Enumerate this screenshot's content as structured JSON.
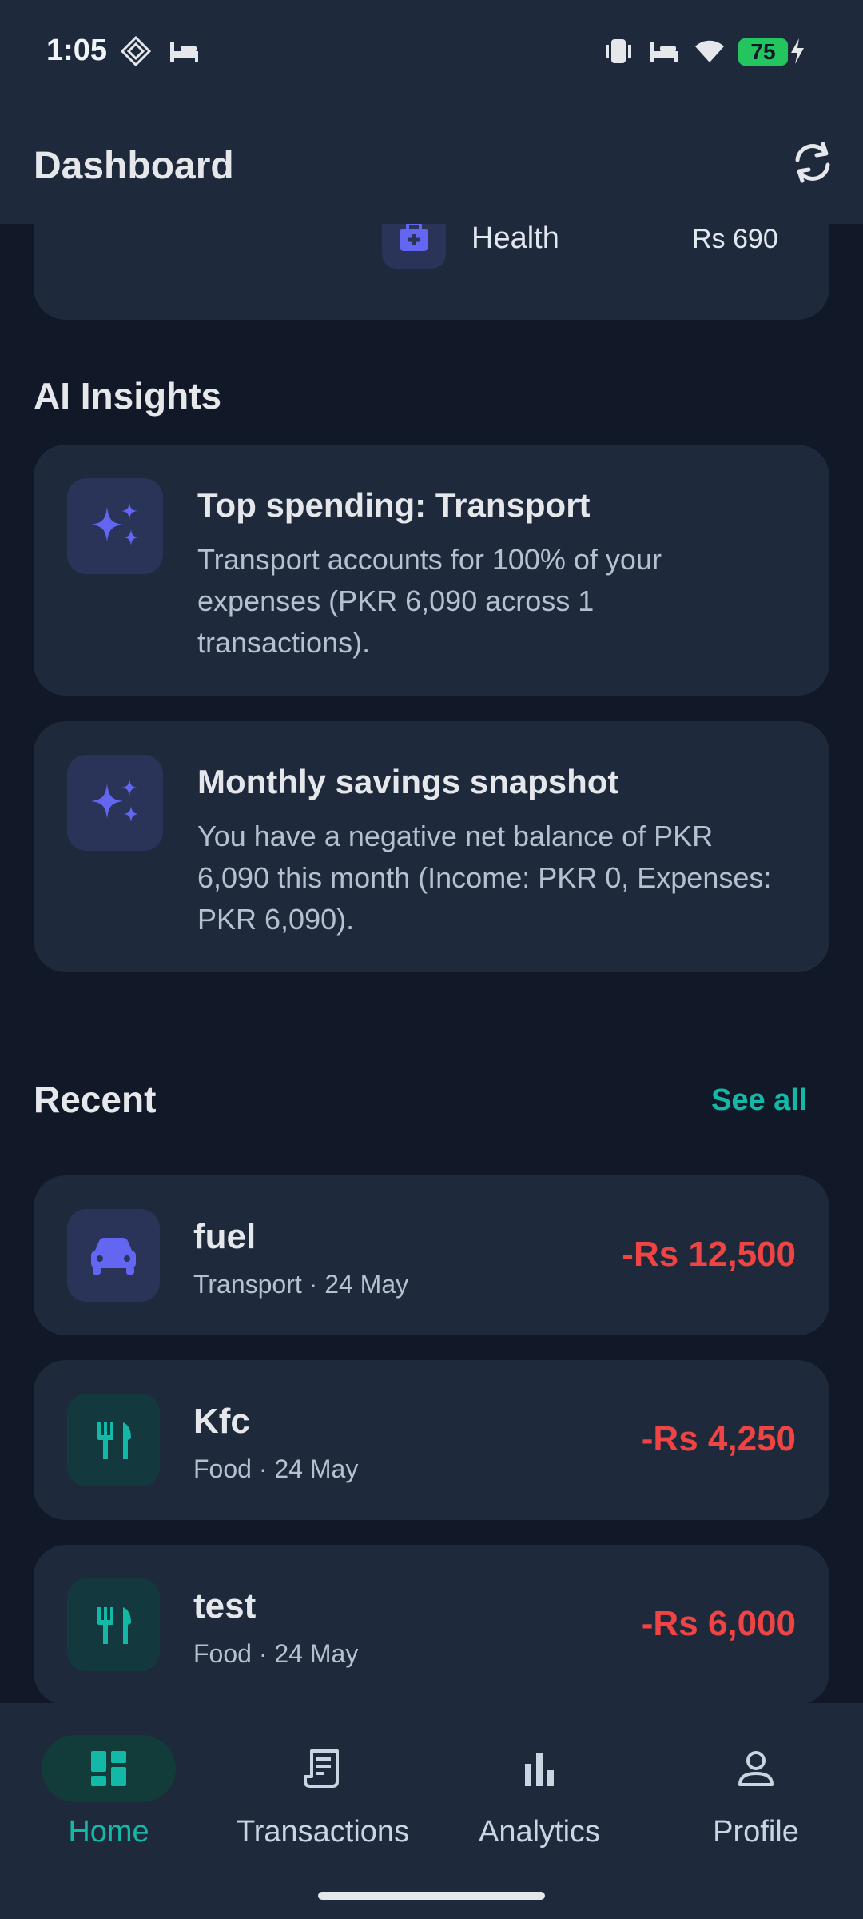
{
  "status_bar": {
    "time": "1:05",
    "battery": "75"
  },
  "header": {
    "title": "Dashboard"
  },
  "top_card_partial": {
    "category": "Health",
    "amount": "Rs 690"
  },
  "ai_insights": {
    "title": "AI Insights",
    "items": [
      {
        "title": "Top spending: Transport",
        "text": "Transport accounts for 100% of your expenses (PKR 6,090 across 1 transactions)."
      },
      {
        "title": "Monthly savings snapshot",
        "text": "You have a negative net balance of PKR 6,090 this month (Income: PKR 0, Expenses: PKR 6,090)."
      }
    ]
  },
  "recent": {
    "title": "Recent",
    "see_all": "See all",
    "items": [
      {
        "name": "fuel",
        "meta": "Transport · 24 May",
        "amount": "-Rs 12,500",
        "icon": "car-icon"
      },
      {
        "name": "Kfc",
        "meta": "Food · 24 May",
        "amount": "-Rs 4,250",
        "icon": "fork-knife-icon"
      },
      {
        "name": "test",
        "meta": "Food · 24 May",
        "amount": "-Rs 6,000",
        "icon": "fork-knife-icon"
      }
    ]
  },
  "nav": {
    "items": [
      {
        "label": "Home",
        "icon": "dashboard-icon",
        "active": true
      },
      {
        "label": "Transactions",
        "icon": "receipt-icon"
      },
      {
        "label": "Analytics",
        "icon": "bar-chart-icon"
      },
      {
        "label": "Profile",
        "icon": "person-icon"
      }
    ]
  },
  "colors": {
    "accent": "#14b8a6",
    "expense": "#ef4444",
    "insight_icon": "#6366f1"
  }
}
